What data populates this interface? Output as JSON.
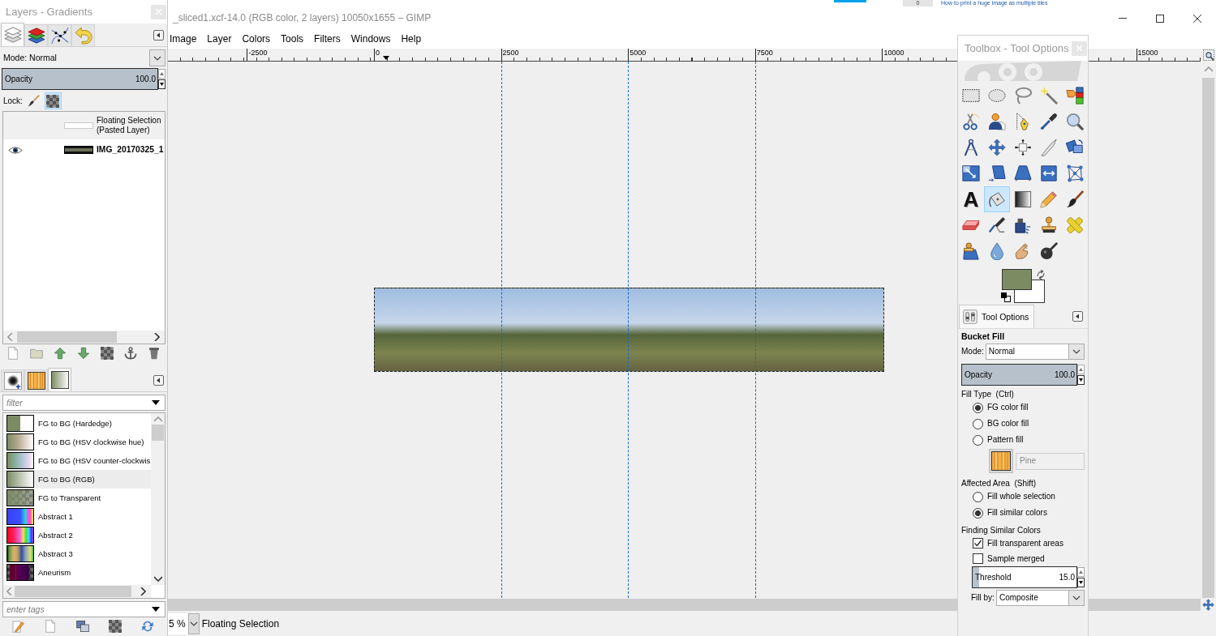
{
  "browser_tab": {
    "counter": "0",
    "title": "How to print a huge image as multiple tiles"
  },
  "image_window": {
    "title": "_sliced1.xcf-14.0 (RGB color, 2 layers) 10050x1655 – GIMP",
    "menu": [
      "Image",
      "Layer",
      "Colors",
      "Tools",
      "Filters",
      "Windows",
      "Help"
    ],
    "ruler": [
      "-2500",
      "0",
      "2500",
      "5000",
      "7500",
      "10000",
      "15000"
    ],
    "status_bar": {
      "zoom": "5 %",
      "message": "Floating Selection"
    }
  },
  "layers_dock": {
    "title": "Layers - Gradients",
    "tabs": [
      {
        "kind": "layers",
        "selected": true
      },
      {
        "kind": "channels",
        "selected": false
      },
      {
        "kind": "paths",
        "selected": false
      },
      {
        "kind": "undo",
        "selected": false
      }
    ],
    "mode": {
      "label": "Mode:",
      "value": "Normal"
    },
    "opacity": {
      "label": "Opacity",
      "reading": "100.0",
      "level": 1
    },
    "lock": {
      "label": "Lock:",
      "toggles": [
        {
          "kind": "pixels",
          "active": false
        },
        {
          "kind": "alpha",
          "active": true
        }
      ]
    },
    "layers": [
      {
        "kind": "floating",
        "name": "Floating Selection\n(Pasted Layer)",
        "visible": false,
        "selected": true
      },
      {
        "kind": "layer",
        "name": "IMG_20170325_1",
        "visible": true,
        "selected": false
      }
    ]
  },
  "gradients_dock": {
    "tabs": [
      {
        "kind": "brushes",
        "selected": false
      },
      {
        "kind": "patterns",
        "selected": false
      },
      {
        "kind": "gradients",
        "selected": true
      }
    ],
    "filter": {
      "placeholder": "filter"
    },
    "gradients": [
      {
        "name": "FG to BG (Hardedge)",
        "selected": false
      },
      {
        "name": "FG to BG (HSV clockwise hue)",
        "selected": false
      },
      {
        "name": "FG to BG (HSV counter-clockwis",
        "selected": false
      },
      {
        "name": "FG to BG (RGB)",
        "selected": true
      },
      {
        "name": "FG to Transparent",
        "selected": false
      },
      {
        "name": "Abstract 1",
        "selected": false
      },
      {
        "name": "Abstract 2",
        "selected": false
      },
      {
        "name": "Abstract 3",
        "selected": false
      },
      {
        "name": "Aneurism",
        "selected": false
      }
    ],
    "tags": {
      "placeholder": "enter tags"
    }
  },
  "toolbox": {
    "title": "Toolbox - Tool Options",
    "tools": [
      {
        "kind": "rectselect",
        "selected": false
      },
      {
        "kind": "ellipseselect",
        "selected": false
      },
      {
        "kind": "lasso",
        "selected": false
      },
      {
        "kind": "wand",
        "selected": false
      },
      {
        "kind": "bycolor",
        "selected": false
      },
      {
        "kind": "scissors",
        "selected": false
      },
      {
        "kind": "foreground",
        "selected": false
      },
      {
        "kind": "paths",
        "selected": false
      },
      {
        "kind": "picker",
        "selected": false
      },
      {
        "kind": "zoom",
        "selected": false
      },
      {
        "kind": "measure",
        "selected": false
      },
      {
        "kind": "move",
        "selected": false
      },
      {
        "kind": "align",
        "selected": false
      },
      {
        "kind": "crop",
        "selected": false
      },
      {
        "kind": "rotate",
        "selected": false
      },
      {
        "kind": "scale",
        "selected": false
      },
      {
        "kind": "shear",
        "selected": false
      },
      {
        "kind": "perspective",
        "selected": false
      },
      {
        "kind": "flip",
        "selected": false
      },
      {
        "kind": "cage",
        "selected": false
      },
      {
        "kind": "text",
        "glyph": "A",
        "selected": false
      },
      {
        "kind": "bucket",
        "selected": true
      },
      {
        "kind": "gradient",
        "selected": false
      },
      {
        "kind": "pencil",
        "selected": false
      },
      {
        "kind": "brush",
        "selected": false
      },
      {
        "kind": "eraser",
        "selected": false
      },
      {
        "kind": "airbrush",
        "selected": false
      },
      {
        "kind": "ink",
        "selected": false
      },
      {
        "kind": "clone",
        "selected": false
      },
      {
        "kind": "heal",
        "selected": false
      },
      {
        "kind": "perspclone",
        "selected": false
      },
      {
        "kind": "blur",
        "selected": false
      },
      {
        "kind": "smudge",
        "selected": false
      },
      {
        "kind": "dodge",
        "selected": false
      }
    ],
    "colors": [
      {
        "kind": "foreground",
        "color": "#7d8b63"
      },
      {
        "kind": "background",
        "color": "#ffffff"
      }
    ]
  },
  "tool_options": {
    "tabs": [
      {
        "label": "Tool Options",
        "selected": true
      }
    ],
    "tool": "Bucket Fill",
    "mode": {
      "label": "Mode:",
      "value": "Normal"
    },
    "opacity": {
      "label": "Opacity",
      "reading": "100.0",
      "level": 1
    },
    "fill_type": {
      "label": "Fill Type  (Ctrl)",
      "options": [
        {
          "label": "FG color fill",
          "selected": true
        },
        {
          "label": "BG color fill",
          "selected": false
        },
        {
          "label": "Pattern fill",
          "selected": false
        }
      ]
    },
    "pattern": {
      "name": "Pine",
      "disabled": true
    },
    "affected_area": {
      "label": "Affected Area  (Shift)",
      "options": [
        {
          "label": "Fill whole selection",
          "selected": false
        },
        {
          "label": "Fill similar colors",
          "selected": true
        }
      ]
    },
    "similar_colors": {
      "label": "Finding Similar Colors",
      "options": [
        {
          "label": "Fill transparent areas",
          "checked": true
        },
        {
          "label": "Sample merged",
          "checked": false
        }
      ]
    },
    "threshold": {
      "label": "Threshold",
      "reading": "15.0",
      "level": 0.06
    },
    "fill_by": {
      "label": "Fill by:",
      "value": "Composite"
    }
  }
}
